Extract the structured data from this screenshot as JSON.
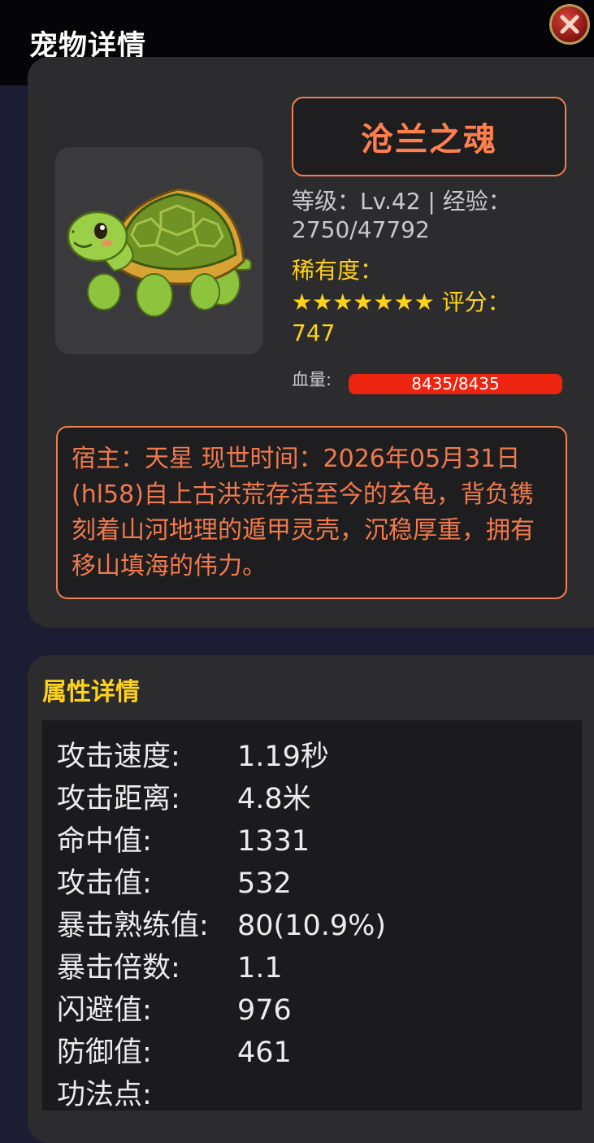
{
  "header": {
    "title": "宠物详情",
    "close_icon": "close-icon",
    "close_color": "#8e1a17"
  },
  "pet": {
    "image_icon": "turtle-icon",
    "name": "沧兰之魂",
    "level_line1": "等级：Lv.42 | 经验：",
    "level_line2": "2750/47792",
    "rarity_label": "稀有度：",
    "rarity_stars_score": "★★★★★★★ 评分：",
    "rarity_stars": 7,
    "score": "747",
    "hp_label": "血量:",
    "hp_text": "8435/8435",
    "hp_fraction": 1.0,
    "description": "宿主：天星 现世时间：2026年05月31日(hl58)自上古洪荒存活至今的玄龟，背负镌刻着山河地理的遁甲灵壳，沉稳厚重，拥有移山填海的伟力。"
  },
  "attributes": {
    "title": "属性详情",
    "rows": [
      {
        "label": "攻击速度:",
        "value": "1.19秒"
      },
      {
        "label": "攻击距离:",
        "value": "4.8米"
      },
      {
        "label": "命中值:",
        "value": "1331"
      },
      {
        "label": "攻击值:",
        "value": "532"
      },
      {
        "label": "暴击熟练值:",
        "value": "80(10.9%)"
      },
      {
        "label": "暴击倍数:",
        "value": "1.1"
      },
      {
        "label": "闪避值:",
        "value": "976"
      },
      {
        "label": "防御值:",
        "value": "461"
      },
      {
        "label": "功法点:",
        "value": ""
      }
    ]
  },
  "colors": {
    "accent_orange": "#f08050",
    "rarity_gold": "#ffd21a",
    "hp_red": "#e8230f"
  }
}
